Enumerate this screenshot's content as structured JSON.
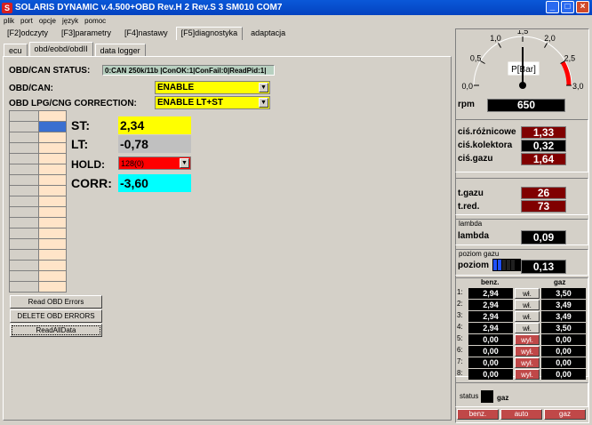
{
  "window": {
    "title": "SOLARIS DYNAMIC v.4.500+OBD Rev.H 2 Rev.S 3 SM010  COM7",
    "icon": "S"
  },
  "menu": [
    "plik",
    "port",
    "opcje",
    "język",
    "pomoc"
  ],
  "top_tabs": [
    "[F2]odczyty",
    "[F3]parametry",
    "[F4]nastawy",
    "[F5]diagnostyka",
    "adaptacja"
  ],
  "active_top_tab": "[F5]diagnostyka",
  "sub_tabs": [
    "ecu",
    "obd/eobd/obdII",
    "data logger"
  ],
  "active_sub_tab": "obd/eobd/obdII",
  "obd": {
    "status_label": "OBD/CAN STATUS:",
    "status_value": "0:CAN 250k/11b |ConOK:1|ConFail:0|ReadPid:1|",
    "obdcan_label": "OBD/CAN:",
    "obdcan_value": "ENABLE",
    "correction_label": "OBD LPG/CNG CORRECTION:",
    "correction_value": "ENABLE LT+ST",
    "st_label": "ST:",
    "st_value": "2,34",
    "lt_label": "LT:",
    "lt_value": "-0,78",
    "hold_label": "HOLD:",
    "hold_value": "128(0)",
    "corr_label": "CORR:",
    "corr_value": "-3,60"
  },
  "buttons": {
    "read_errors": "Read OBD Errors",
    "delete_errors": "DELETE OBD ERRORS",
    "read_all": "ReadAllData"
  },
  "gauge": {
    "label": "P[Bar]",
    "ticks": [
      "0,0",
      "0,5",
      "1,0",
      "1,5",
      "2,0",
      "2,5",
      "3,0"
    ],
    "value": 1.5
  },
  "rpm": {
    "label": "rpm",
    "value": "650"
  },
  "pressures": [
    {
      "label": "ciś.różnicowe",
      "value": "1,33"
    },
    {
      "label": "ciś.kolektora",
      "value": "0,32"
    },
    {
      "label": "ciś.gazu",
      "value": "1,64"
    }
  ],
  "temps": [
    {
      "label": "t.gazu",
      "value": "26"
    },
    {
      "label": "t.red.",
      "value": "73"
    }
  ],
  "lambda": {
    "group": "lambda",
    "label": "lambda",
    "value": "0,09"
  },
  "level": {
    "group": "poziom gazu",
    "label": "poziom",
    "value": "0,13"
  },
  "injectors": {
    "col_benz": "benz.",
    "col_gaz": "gaz",
    "rows": [
      {
        "n": "1:",
        "benz": "2,94",
        "btn": "wł.",
        "gaz": "3,50"
      },
      {
        "n": "2:",
        "benz": "2,94",
        "btn": "wł.",
        "gaz": "3,49"
      },
      {
        "n": "3:",
        "benz": "2,94",
        "btn": "wł.",
        "gaz": "3,49"
      },
      {
        "n": "4:",
        "benz": "2,94",
        "btn": "wł.",
        "gaz": "3,50"
      },
      {
        "n": "5:",
        "benz": "0,00",
        "btn": "wył.",
        "gaz": "0,00"
      },
      {
        "n": "6:",
        "benz": "0,00",
        "btn": "wył.",
        "gaz": "0,00"
      },
      {
        "n": "7:",
        "benz": "0,00",
        "btn": "wył.",
        "gaz": "0,00"
      },
      {
        "n": "8:",
        "benz": "0,00",
        "btn": "wył.",
        "gaz": "0,00"
      }
    ]
  },
  "status": {
    "label": "status",
    "value": "gaz"
  },
  "mode_buttons": [
    "benz.",
    "auto",
    "gaz"
  ],
  "colors": {
    "title_bar": "#0342c0",
    "yellow": "#ffff00",
    "cyan": "#00ffff",
    "red_box": "#800000",
    "button_red": "#c04848"
  }
}
